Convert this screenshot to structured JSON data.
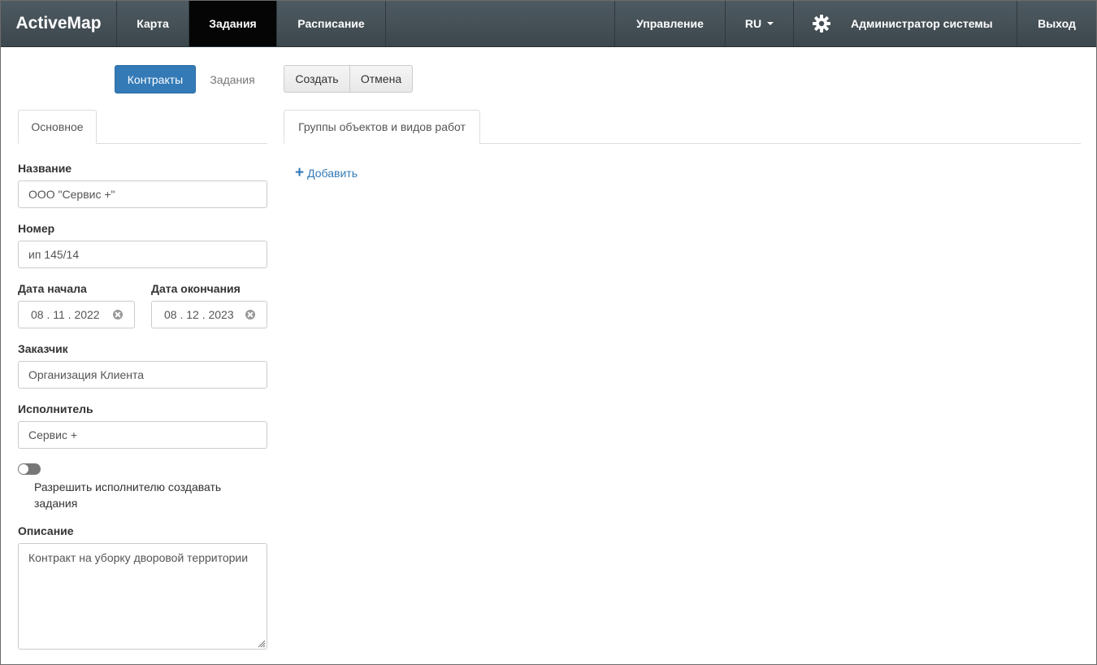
{
  "navbar": {
    "brand": "ActiveMap",
    "items": [
      {
        "label": "Карта"
      },
      {
        "label": "Задания"
      },
      {
        "label": "Расписание"
      }
    ],
    "management": "Управление",
    "language": "RU",
    "user": "Администратор системы",
    "logout": "Выход"
  },
  "subnav": {
    "contracts": "Контракты",
    "tasks": "Задания"
  },
  "actions": {
    "create": "Создать",
    "cancel": "Отмена"
  },
  "left_tab": "Основное",
  "right_tab": "Группы объектов и видов работ",
  "form": {
    "name_label": "Название",
    "name_value": "ООО \"Сервис +\"",
    "number_label": "Номер",
    "number_value": "ип 145/14",
    "start_label": "Дата начала",
    "start_value": "08 . 11 . 2022",
    "end_label": "Дата окончания",
    "end_value": "08 . 12 . 2023",
    "customer_label": "Заказчик",
    "customer_value": "Организация Клиента",
    "executor_label": "Исполнитель",
    "executor_value": "Сервис +",
    "allow_toggle_label": "Разрешить исполнителю создавать задания",
    "allow_toggle_on": false,
    "description_label": "Описание",
    "description_value": "Контракт на уборку дворовой территории"
  },
  "add_link": "Добавить",
  "icons": {
    "settings": "gear-icon",
    "add": "plus-icon",
    "clear": "clear-icon",
    "dropdown": "caret-down-icon"
  },
  "colors": {
    "navbar": "#434e54",
    "primary": "#337ab7",
    "active_nav": "#050505"
  }
}
